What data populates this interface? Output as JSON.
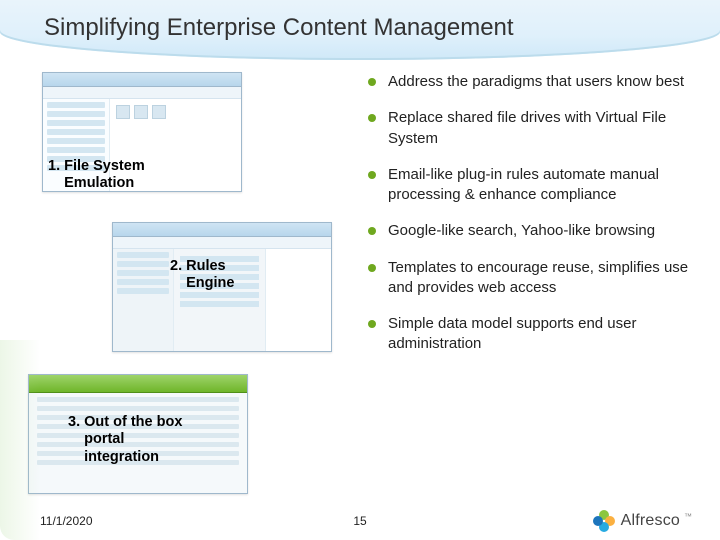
{
  "title": "Simplifying Enterprise Content Management",
  "labels": {
    "l1a": "1. File System",
    "l1b": "Emulation",
    "l2a": "2. Rules",
    "l2b": "Engine",
    "l3a": "3. Out of the box",
    "l3b": "portal",
    "l3c": "integration"
  },
  "bullets": [
    "Address the paradigms that users know best",
    "Replace shared file drives with Virtual File System",
    "Email-like plug-in rules automate manual processing & enhance compliance",
    "Google-like search, Yahoo-like browsing",
    "Templates to encourage reuse, simplifies use and provides web access",
    "Simple data model supports end user administration"
  ],
  "footer": {
    "date": "11/1/2020",
    "page": "15",
    "brand": "Alfresco"
  }
}
